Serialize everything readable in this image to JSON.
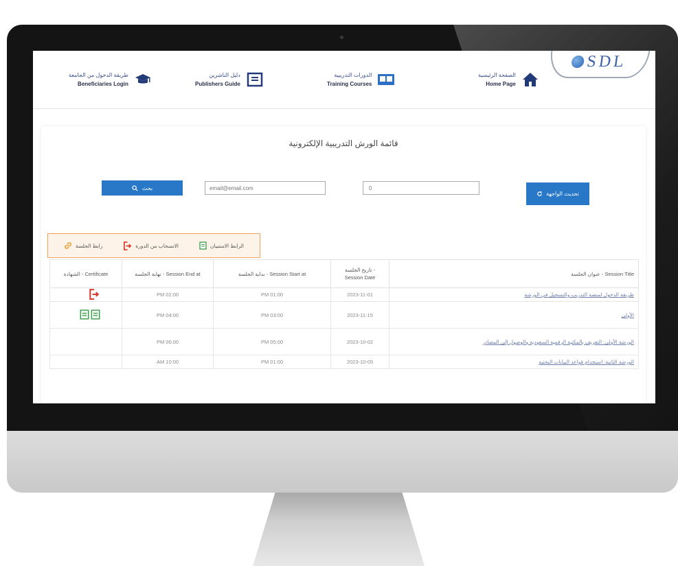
{
  "header": {
    "logo_text": "SDL",
    "nav": [
      {
        "ar": "طريقة الدخول من الجامعة",
        "en": "Beneficiaries Login",
        "icon": "graduation-cap-icon"
      },
      {
        "ar": "دليل الناشرين",
        "en": "Publishers Guide",
        "icon": "document-icon"
      },
      {
        "ar": "الدورات التدريبية",
        "en": "Training Courses",
        "icon": "presentation-icon"
      },
      {
        "ar": "الصفحة الرئيسية",
        "en": "Home Page",
        "icon": "home-icon"
      }
    ]
  },
  "main": {
    "title": "قائمة الورش التدريبية الإلكترونية",
    "search_button": "بحث",
    "email_placeholder": "email@email.com",
    "id_value": "0",
    "refresh_button": "تحديث الواجهة"
  },
  "legend": {
    "join_session": "رابط الجلسة",
    "withdraw": "الانسحاب من الدورة",
    "view_certificate": "الرابط الاستبيان",
    "colors": {
      "border": "#f2a25a",
      "exit": "#d9382b",
      "cert": "#3a9b4a"
    }
  },
  "table": {
    "headers": {
      "title": "عنوان الجلسة - Session Title",
      "date": "تاريخ الجلسة - Session Date",
      "start": "بداية الجلسة - Session Start at",
      "end": "نهاية الجلسة - Session End at",
      "cert": "الشهادة - Certificate"
    },
    "rows": [
      {
        "title": "طريقة الدخول لمنصة التدريب والتسجيل في الورشة",
        "date": "2023-11-01",
        "start": "PM 01:00",
        "end": "PM 02:00"
      },
      {
        "title": "الأولى",
        "date": "2023-11-15",
        "start": "PM 03:00",
        "end": "PM 04:00"
      },
      {
        "title": "الورشة الأولى: التعريف بالمكتبة الرقمية السعودية والوصول إلى المصادر",
        "date": "2023-10-02",
        "start": "PM 05:00",
        "end": "PM 06:00"
      },
      {
        "title": "الورشة الثانية: استخدام قواعد البيانات البحثية",
        "date": "2023-10-05",
        "start": "PM 01:00",
        "end": "AM 10:00"
      }
    ]
  }
}
